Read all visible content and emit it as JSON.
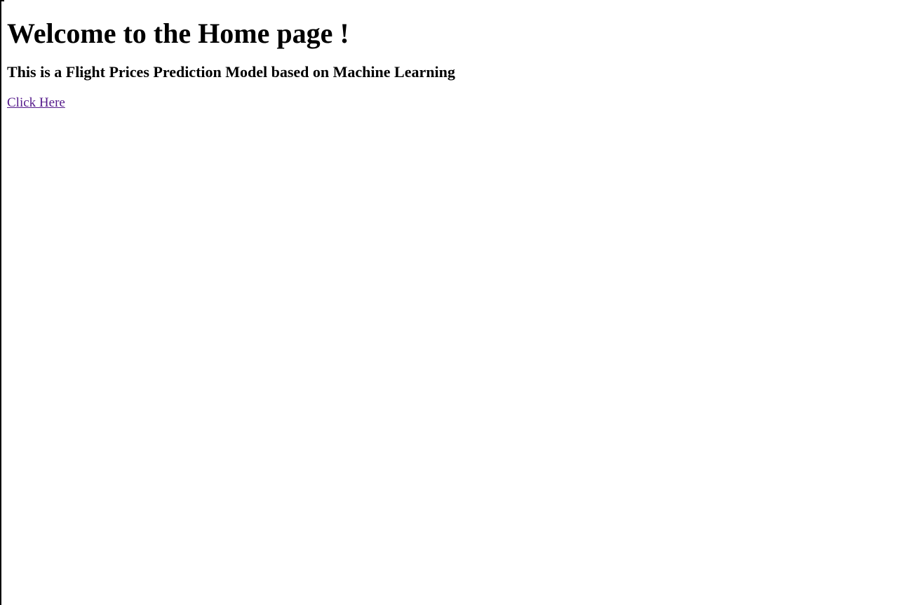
{
  "page": {
    "heading": "Welcome to the Home page !",
    "subheading": "This is a Flight Prices Prediction Model based on Machine Learning",
    "link_text": "Click Here"
  },
  "colors": {
    "background": "#ffffff",
    "text": "#000000",
    "visited_link": "#551a8b"
  }
}
